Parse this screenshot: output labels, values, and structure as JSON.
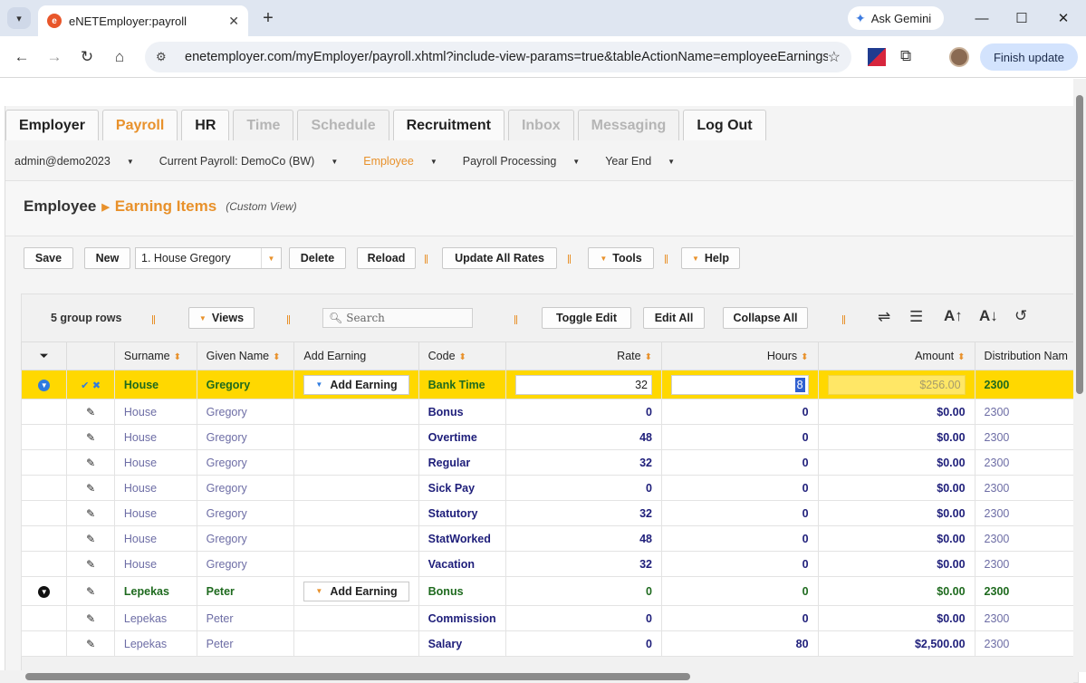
{
  "browser": {
    "tab_title": "eNETEmployer:payroll",
    "favicon_letter": "e",
    "new_tab": "+",
    "ask_gemini": "Ask Gemini",
    "url": "enetemployer.com/myEmployer/payroll.xhtml?include-view-params=true&tableActionName=employeeEarnings",
    "finish_update": "Finish update"
  },
  "menu": {
    "tabs": [
      {
        "label": "Employer",
        "state": "normal"
      },
      {
        "label": "Payroll",
        "state": "active"
      },
      {
        "label": "HR",
        "state": "normal"
      },
      {
        "label": "Time",
        "state": "disabled"
      },
      {
        "label": "Schedule",
        "state": "disabled"
      },
      {
        "label": "Recruitment",
        "state": "normal"
      },
      {
        "label": "Inbox",
        "state": "disabled"
      },
      {
        "label": "Messaging",
        "state": "disabled"
      },
      {
        "label": "Log Out",
        "state": "normal"
      }
    ]
  },
  "subnav": {
    "user": "admin@demo2023",
    "current_payroll": "Current Payroll: DemoCo (BW)",
    "employee": "Employee",
    "payroll_processing": "Payroll Processing",
    "year_end": "Year End"
  },
  "breadcrumb": {
    "parent": "Employee",
    "current": "Earning Items",
    "view_note": "(Custom View)"
  },
  "actions": {
    "save": "Save",
    "new": "New",
    "employee_select": "1. House Gregory",
    "delete": "Delete",
    "reload": "Reload",
    "update_all_rates": "Update All Rates",
    "tools": "Tools",
    "help": "Help"
  },
  "grid_toolbar": {
    "group_rows": "5 group rows",
    "views": "Views",
    "search_placeholder": "Search",
    "toggle_edit": "Toggle Edit",
    "edit_all": "Edit All",
    "collapse_all": "Collapse All"
  },
  "columns": {
    "surname": "Surname",
    "given_name": "Given Name",
    "add_earning": "Add Earning",
    "code": "Code",
    "rate": "Rate",
    "hours": "Hours",
    "amount": "Amount",
    "distribution": "Distribution Nam"
  },
  "rows": {
    "r0": {
      "surname": "House",
      "given": "Gregory",
      "add": "Add Earning",
      "code": "Bank Time",
      "rate": "32",
      "hours": "8",
      "amount": "$256.00",
      "dist": "2300"
    },
    "r1": {
      "surname": "House",
      "given": "Gregory",
      "code": "Bonus",
      "rate": "0",
      "hours": "0",
      "amount": "$0.00",
      "dist": "2300"
    },
    "r2": {
      "surname": "House",
      "given": "Gregory",
      "code": "Overtime",
      "rate": "48",
      "hours": "0",
      "amount": "$0.00",
      "dist": "2300"
    },
    "r3": {
      "surname": "House",
      "given": "Gregory",
      "code": "Regular",
      "rate": "32",
      "hours": "0",
      "amount": "$0.00",
      "dist": "2300"
    },
    "r4": {
      "surname": "House",
      "given": "Gregory",
      "code": "Sick Pay",
      "rate": "0",
      "hours": "0",
      "amount": "$0.00",
      "dist": "2300"
    },
    "r5": {
      "surname": "House",
      "given": "Gregory",
      "code": "Statutory",
      "rate": "32",
      "hours": "0",
      "amount": "$0.00",
      "dist": "2300"
    },
    "r6": {
      "surname": "House",
      "given": "Gregory",
      "code": "StatWorked",
      "rate": "48",
      "hours": "0",
      "amount": "$0.00",
      "dist": "2300"
    },
    "r7": {
      "surname": "House",
      "given": "Gregory",
      "code": "Vacation",
      "rate": "32",
      "hours": "0",
      "amount": "$0.00",
      "dist": "2300"
    },
    "r8": {
      "surname": "Lepekas",
      "given": "Peter",
      "add": "Add Earning",
      "code": "Bonus",
      "rate": "0",
      "hours": "0",
      "amount": "$0.00",
      "dist": "2300"
    },
    "r9": {
      "surname": "Lepekas",
      "given": "Peter",
      "code": "Commission",
      "rate": "0",
      "hours": "0",
      "amount": "$0.00",
      "dist": "2300"
    },
    "r10": {
      "surname": "Lepekas",
      "given": "Peter",
      "code": "Salary",
      "rate": "0",
      "hours": "80",
      "amount": "$2,500.00",
      "dist": "2300"
    }
  },
  "colors": {
    "accent": "#e8912b",
    "selected_row": "#ffd800",
    "group_text": "#1e6a1e",
    "value_text": "#1e1e7a"
  }
}
